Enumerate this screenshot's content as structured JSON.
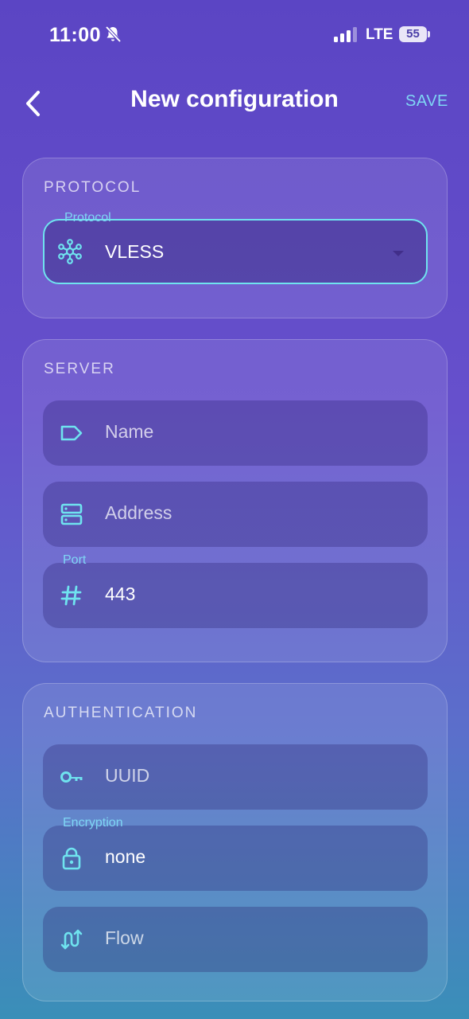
{
  "status_bar": {
    "time": "11:00",
    "network": "LTE",
    "battery": "55"
  },
  "app_bar": {
    "title": "New configuration",
    "save_label": "SAVE"
  },
  "protocol_section": {
    "title": "PROTOCOL",
    "protocol_field": {
      "label": "Protocol",
      "value": "VLESS"
    }
  },
  "server_section": {
    "title": "SERVER",
    "name_field": {
      "placeholder": "Name"
    },
    "address_field": {
      "placeholder": "Address"
    },
    "port_field": {
      "label": "Port",
      "value": "443"
    }
  },
  "authentication_section": {
    "title": "AUTHENTICATION",
    "uuid_field": {
      "placeholder": "UUID"
    },
    "encryption_field": {
      "label": "Encryption",
      "value": "none"
    },
    "flow_field": {
      "placeholder": "Flow"
    }
  },
  "colors": {
    "accent": "#6fe3ef",
    "save": "#7fd6f4"
  },
  "icons": [
    "hub-icon",
    "label-tag-icon",
    "server-icon",
    "hash-icon",
    "key-icon",
    "lock-icon",
    "flow-arrows-icon"
  ]
}
